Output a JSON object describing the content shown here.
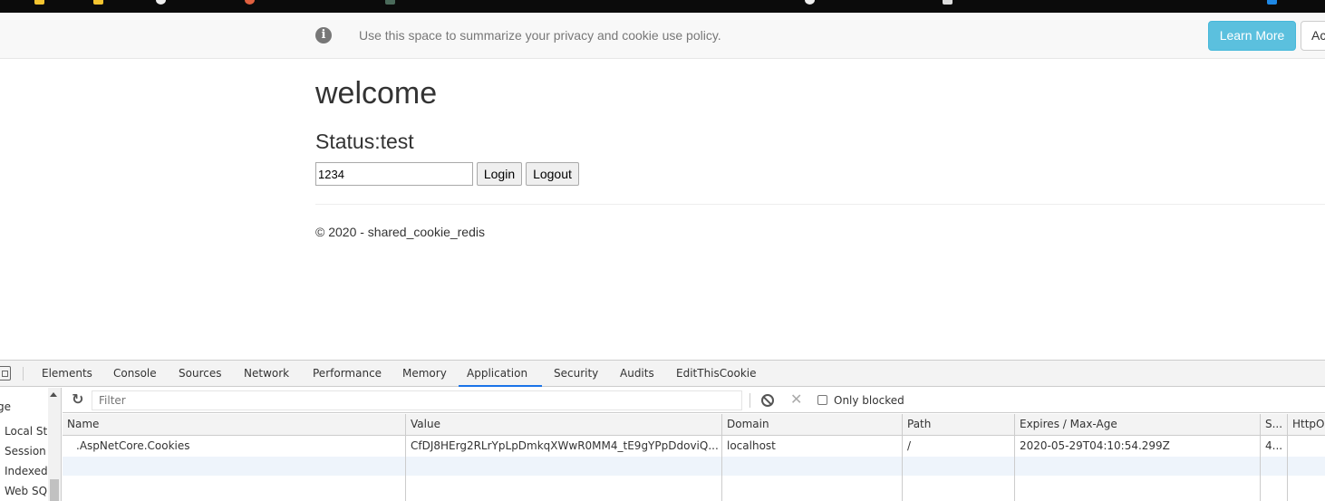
{
  "banner": {
    "info_icon": "i",
    "message": "Use this space to summarize your privacy and cookie use policy.",
    "learn_more_label": "Learn More",
    "accept_label": "Ac"
  },
  "page": {
    "title": "welcome",
    "status": "Status:test",
    "input_value": "1234",
    "login_label": "Login",
    "logout_label": "Logout",
    "footer": "© 2020 - shared_cookie_redis"
  },
  "devtools": {
    "tabs": [
      {
        "label": "Elements"
      },
      {
        "label": "Console"
      },
      {
        "label": "Sources"
      },
      {
        "label": "Network"
      },
      {
        "label": "Performance"
      },
      {
        "label": "Memory"
      },
      {
        "label": "Application"
      },
      {
        "label": "Security"
      },
      {
        "label": "Audits"
      },
      {
        "label": "EditThisCookie"
      }
    ],
    "active_tab": "Application",
    "sidebar": {
      "items": [
        {
          "label": "ge"
        },
        {
          "label": "Local St"
        },
        {
          "label": "Session"
        },
        {
          "label": "Indexed"
        },
        {
          "label": "Web SQ"
        }
      ]
    },
    "toolbar": {
      "filter_placeholder": "Filter",
      "only_blocked_label": "Only blocked",
      "delete_icon_glyph": "✕"
    },
    "table": {
      "columns": [
        "Name",
        "Value",
        "Domain",
        "Path",
        "Expires / Max-Age",
        "S...",
        "HttpO"
      ],
      "rows": [
        {
          "name": ".AspNetCore.Cookies",
          "value": "CfDJ8HErg2RLrYpLpDmkqXWwR0MM4_tE9gYPpDdoviQ...",
          "domain": "localhost",
          "path": "/",
          "expires": "2020-05-29T04:10:54.299Z",
          "size": "4..."
        }
      ]
    }
  }
}
